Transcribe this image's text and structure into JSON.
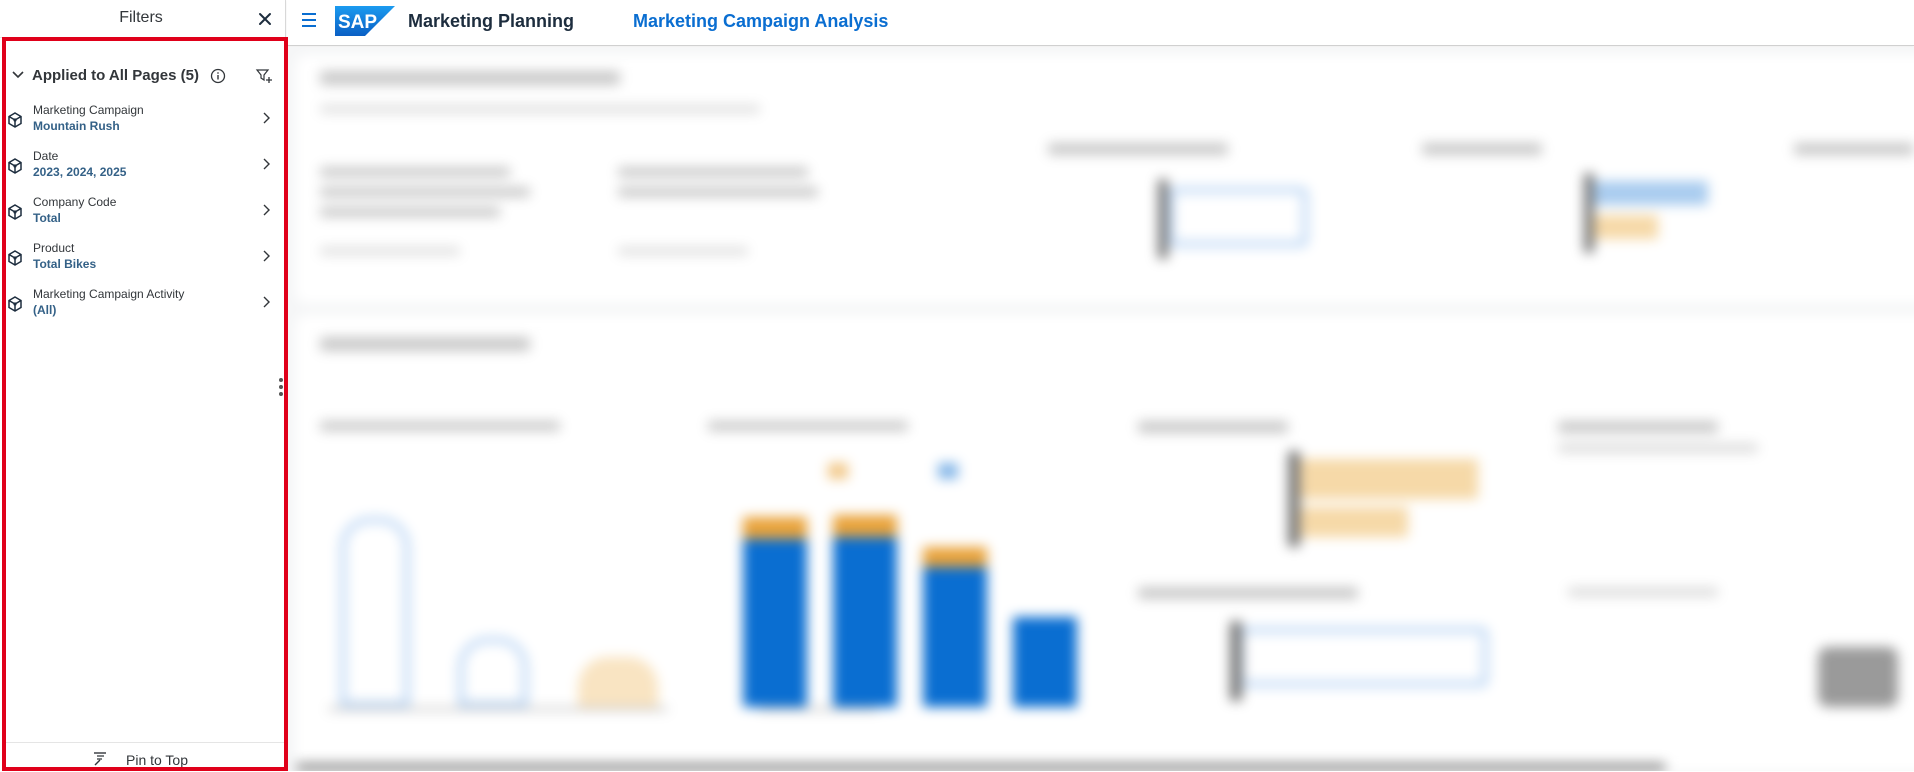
{
  "filters_panel": {
    "title": "Filters",
    "section": {
      "title": "Applied to All Pages (5)"
    },
    "items": [
      {
        "label": "Marketing Campaign",
        "value": "Mountain Rush"
      },
      {
        "label": "Date",
        "value": "2023, 2024, 2025"
      },
      {
        "label": "Company Code",
        "value": "Total"
      },
      {
        "label": "Product",
        "value": "Total Bikes"
      },
      {
        "label": "Marketing Campaign Activity",
        "value": "(All)"
      }
    ],
    "pin_label": "Pin to Top"
  },
  "shell": {
    "logo_text": "SAP",
    "app_title": "Marketing Planning",
    "page_title": "Marketing Campaign Analysis"
  },
  "icons": {
    "close": "close-icon",
    "collapse": "chevron-down-icon",
    "info": "info-icon",
    "add_filter": "filter-add-icon",
    "dimension": "dimension-cube-icon",
    "navigate": "chevron-right-icon",
    "pin": "pin-icon",
    "menu": "hamburger-icon"
  },
  "colors": {
    "accent": "#0a6ed1",
    "filter_value": "#346187",
    "highlight_frame": "#e0001a",
    "chart_orange": "#e9a33b",
    "logo_blue": "#0a6ed1"
  }
}
